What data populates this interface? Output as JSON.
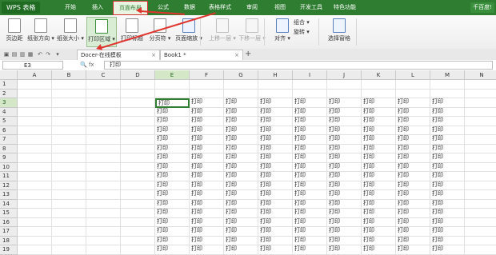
{
  "app": {
    "title": "WPS 表格",
    "menu": [
      "开始",
      "插入",
      "页面布局",
      "公式",
      "数据",
      "表格样式",
      "审阅",
      "视图",
      "开发工具",
      "特色功能"
    ],
    "active_menu_index": 2,
    "help": "千百度!"
  },
  "ribbon": {
    "tools": [
      {
        "label": "页边距"
      },
      {
        "label": "纸张方向 ▾"
      },
      {
        "label": "纸张大小 ▾"
      },
      {
        "label": "打印区域 ▾",
        "active": true
      },
      {
        "label": "打印标题"
      },
      {
        "label": "分页符 ▾"
      },
      {
        "label": "页面缩放 ▾"
      },
      {
        "label": "上移一层 ▾",
        "dim": true
      },
      {
        "label": "下移一层 ▾",
        "dim": true
      },
      {
        "label": "对齐 ▾"
      },
      {
        "label": "选择窗格"
      }
    ],
    "small": {
      "combine": "组合 ▾",
      "rotate": "旋转 ▾"
    }
  },
  "tabs": [
    {
      "label": "Docer-在线模板"
    },
    {
      "label": "Book1 *"
    }
  ],
  "formula": {
    "cell_ref": "E3",
    "value": "打印"
  },
  "sheet": {
    "columns": [
      "A",
      "B",
      "C",
      "D",
      "E",
      "F",
      "G",
      "H",
      "I",
      "J",
      "K",
      "L",
      "M",
      "N"
    ],
    "rows": [
      "1",
      "2",
      "3",
      "4",
      "5",
      "6",
      "7",
      "8",
      "9",
      "10",
      "11",
      "12",
      "13",
      "14",
      "15",
      "16",
      "17",
      "18",
      "19"
    ],
    "cell_text": "打印",
    "selected_col": "E",
    "selected_row": "3"
  },
  "colors": {
    "accent": "#2f7d31",
    "annotation": "#e0342e"
  }
}
